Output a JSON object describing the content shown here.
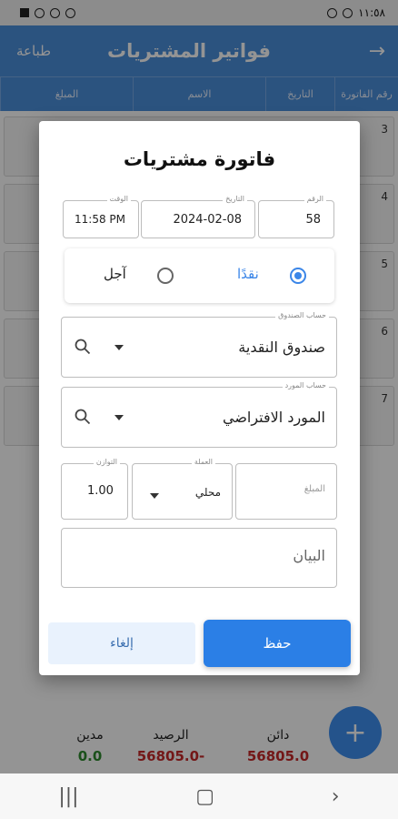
{
  "status_bar": {
    "time": "١١:٥٨"
  },
  "app_bar": {
    "title": "فواتير المشتريات",
    "print_label": "طباعة",
    "back_icon": "arrow-right-icon"
  },
  "table_header": {
    "columns": [
      "رقم الفاتورة",
      "التاريخ",
      "الاسم",
      "المبلغ"
    ]
  },
  "list_rows": [
    {
      "num": "3"
    },
    {
      "num": "4"
    },
    {
      "num": "5"
    },
    {
      "num": "6"
    },
    {
      "num": "7"
    }
  ],
  "totals": {
    "debit_label": "مدين",
    "debit_value": "0.0",
    "balance_label": "الرصيد",
    "balance_value": "56805.0-",
    "credit_label": "دائن",
    "credit_value": "56805.0"
  },
  "colors": {
    "primary": "#4b8fdb",
    "accent": "#2b7fe6",
    "green": "#2e8b2e",
    "red": "#c62828"
  },
  "dialog": {
    "title": "فاتورة مشتريات",
    "number": {
      "label": "الرقم",
      "value": "58"
    },
    "date": {
      "label": "التاريخ",
      "value": "2024-02-08"
    },
    "time": {
      "label": "الوقت",
      "value": "11:58 PM"
    },
    "payment": {
      "cash_label": "نقدًا",
      "credit_label": "آجل",
      "selected": "cash"
    },
    "cash_account": {
      "label": "حساب الصندوق",
      "value": "صندوق النقدية"
    },
    "supplier_account": {
      "label": "حساب المورد",
      "value": "المورد الافتراضي"
    },
    "amount": {
      "placeholder": "المبلغ"
    },
    "currency": {
      "label": "العملة",
      "value": "محلي"
    },
    "rate": {
      "label": "التوازن",
      "value": "1.00"
    },
    "statement": {
      "placeholder": "البيان"
    },
    "save_label": "حفظ",
    "cancel_label": "إلغاء"
  }
}
